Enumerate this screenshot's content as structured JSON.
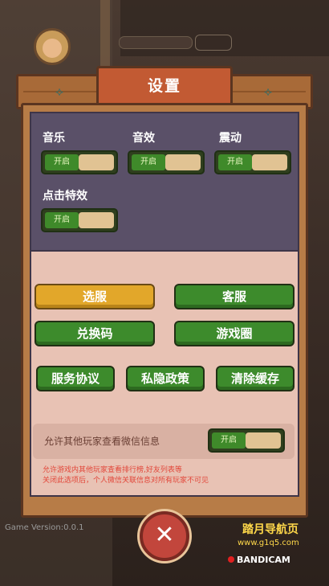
{
  "title": "设置",
  "toggles": [
    {
      "label": "音乐",
      "state": "开启"
    },
    {
      "label": "音效",
      "state": "开启"
    },
    {
      "label": "震动",
      "state": "开启"
    },
    {
      "label": "点击特效",
      "state": "开启"
    }
  ],
  "buttons": {
    "select_server": "选服",
    "customer_service": "客服",
    "redeem_code": "兑换码",
    "game_circle": "游戏圈",
    "service_agreement": "服务协议",
    "privacy_policy": "私隐政策",
    "clear_cache": "清除缓存"
  },
  "privacy": {
    "label": "允许其他玩家查看微信信息",
    "state": "开启",
    "note_line1": "允许游戏内其他玩家查看排行榜,好友列表等",
    "note_line2": "关闭此选项后，个人微信关联信息对所有玩家不可见"
  },
  "close_glyph": "✕",
  "version": "Game Version:0.0.1",
  "brand": "踏月导航页",
  "brand_url": "www.g1q5.com",
  "recorder": "BANDICAM",
  "colors": {
    "green": "#3d8b2c",
    "gold": "#e2a72a",
    "title_plate": "#c25a33",
    "close": "#c2463c"
  }
}
